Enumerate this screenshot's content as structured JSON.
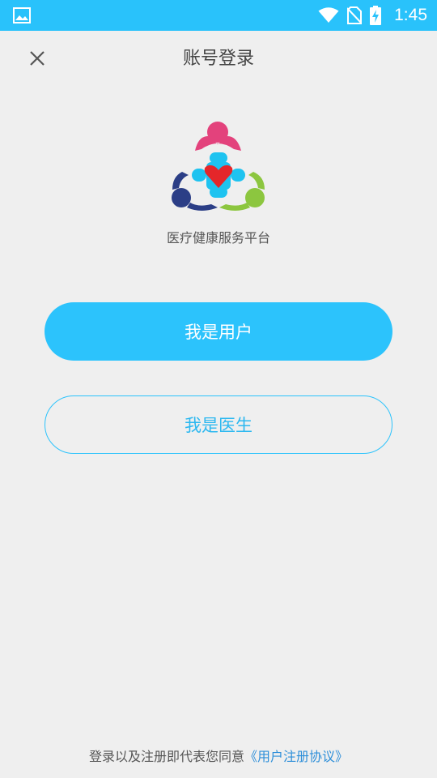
{
  "status_bar": {
    "time": "1:45",
    "icons": [
      "image-icon",
      "wifi-icon",
      "no-sim-icon",
      "battery-charging-icon"
    ]
  },
  "header": {
    "title": "账号登录",
    "close_icon": "close-icon"
  },
  "logo": {
    "caption": "医疗健康服务平台"
  },
  "buttons": {
    "user": "我是用户",
    "doctor": "我是医生"
  },
  "footer": {
    "text": "登录以及注册即代表您同意",
    "link": "《用户注册协议》"
  },
  "colors": {
    "accent": "#2cc3fc",
    "status_bar": "#29c2fb",
    "background": "#efefef",
    "link": "#2e8fd9"
  }
}
